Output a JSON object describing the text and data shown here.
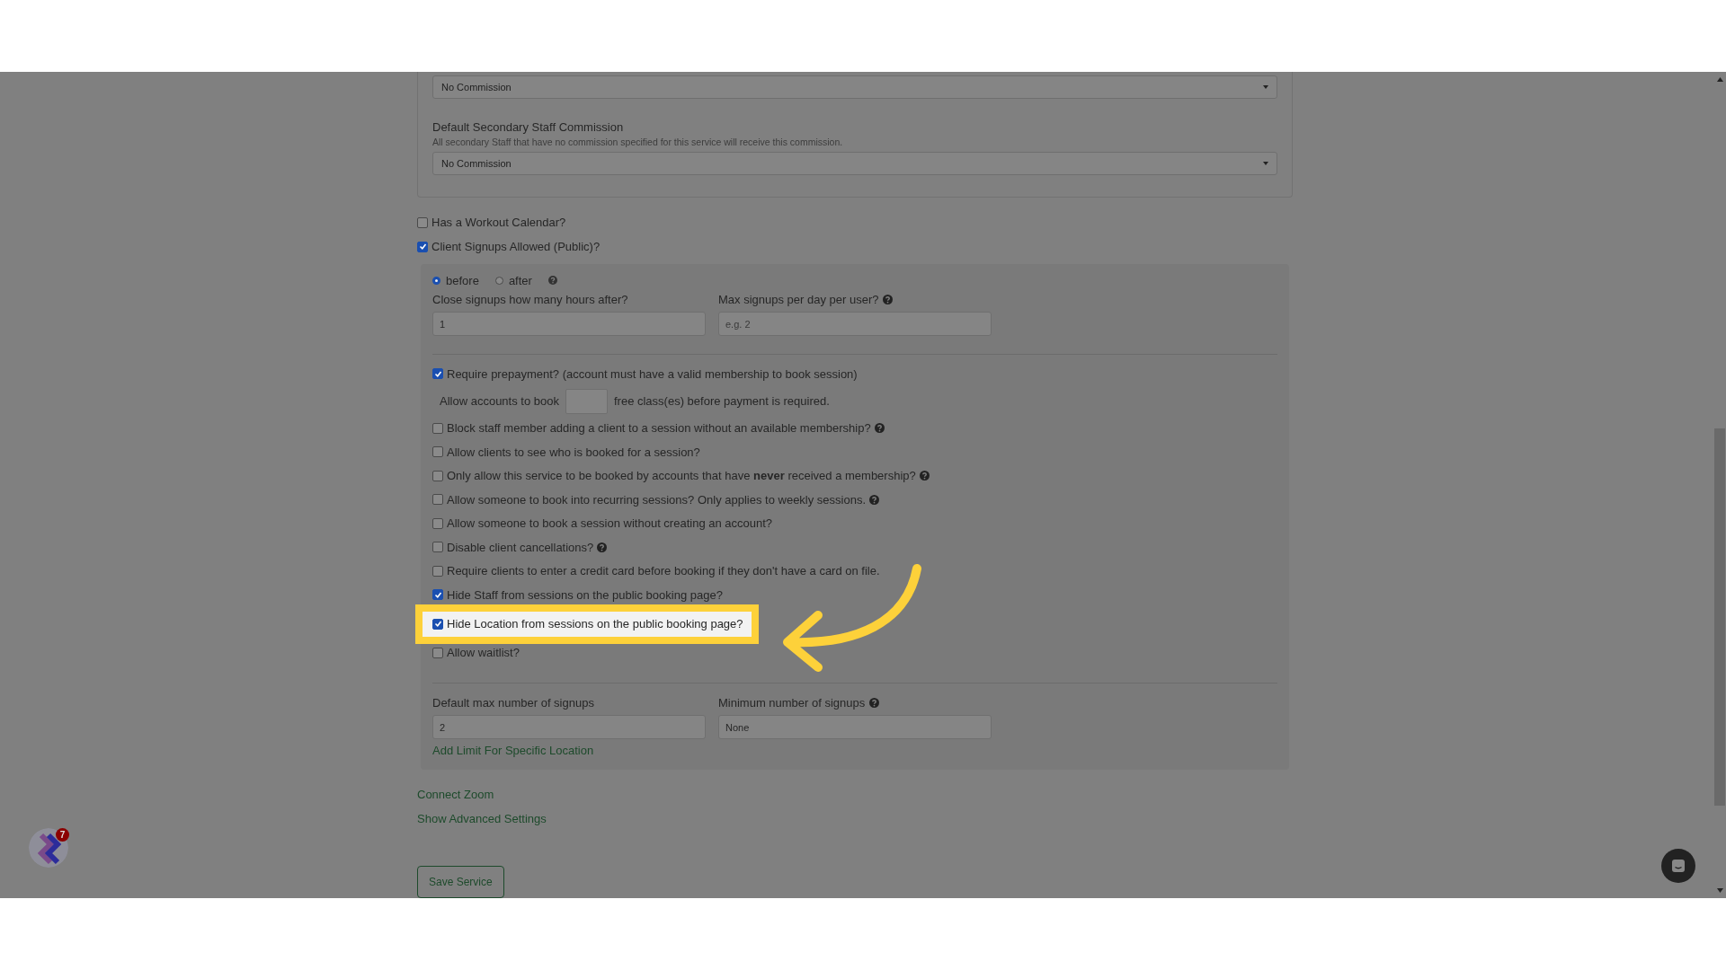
{
  "commission_panel": {
    "primary_select": {
      "value": "No Commission"
    },
    "secondary": {
      "label": "Default Secondary Staff Commission",
      "help": "All secondary Staff that have no commission specified for this service will receive this commission.",
      "select": {
        "value": "No Commission"
      }
    }
  },
  "options": [
    {
      "label": "Has a Workout Calendar?",
      "checked": false
    },
    {
      "label": "Client Signups Allowed (Public)?",
      "checked": true
    }
  ],
  "signup_panel": {
    "timing": [
      {
        "label": "before",
        "selected": true
      },
      {
        "label": "after",
        "selected": false
      }
    ],
    "fields": [
      {
        "label": "Close signups how many hours after?",
        "value": "1",
        "help": false
      },
      {
        "label": "Max signups per day per user?",
        "placeholder": "e.g. 2",
        "help": true
      }
    ],
    "settings": [
      {
        "kind": "checkbox",
        "label": "Require prepayment? (account must have a valid membership to book session)",
        "checked": true,
        "help": false,
        "highlighted": false
      },
      {
        "kind": "free-classes",
        "before": "Allow accounts to book",
        "after": "free class(es) before payment is required."
      },
      {
        "kind": "checkbox",
        "label": "Block staff member adding a client to a session without an available membership?",
        "checked": false,
        "help": true,
        "highlighted": false
      },
      {
        "kind": "checkbox",
        "label": "Allow clients to see who is booked for a session?",
        "checked": false,
        "help": false,
        "highlighted": false
      },
      {
        "kind": "checkbox",
        "label": "Only allow this service to be booked by accounts that have **never** received a membership?",
        "checked": false,
        "help": true,
        "highlighted": false
      },
      {
        "kind": "checkbox",
        "label": "Allow someone to book into recurring sessions? Only applies to weekly sessions.",
        "checked": false,
        "help": true,
        "highlighted": false
      },
      {
        "kind": "checkbox",
        "label": "Allow someone to book a session without creating an account?",
        "checked": false,
        "help": false,
        "highlighted": false
      },
      {
        "kind": "checkbox",
        "label": "Disable client cancellations?",
        "checked": false,
        "help": true,
        "highlighted": false
      },
      {
        "kind": "checkbox",
        "label": "Require clients to enter a credit card before booking if they don't have a card on file.",
        "checked": false,
        "help": false,
        "highlighted": false
      },
      {
        "kind": "checkbox",
        "label": "Hide Staff from sessions on the public booking page?",
        "checked": true,
        "help": false,
        "highlighted": false
      },
      {
        "kind": "checkbox",
        "label": "Hide Location from sessions on the public booking page?",
        "checked": true,
        "help": false,
        "highlighted": true
      },
      {
        "kind": "checkbox",
        "label": "Allow waitlist?",
        "checked": false,
        "help": false,
        "highlighted": false
      }
    ],
    "limit_fields": [
      {
        "label": "Default max number of signups",
        "value": "2",
        "help": false
      },
      {
        "label": "Minimum number of signups",
        "value": "None",
        "help": true
      }
    ],
    "add_limit_link": "Add Limit For Specific Location"
  },
  "links": [
    "Connect Zoom",
    "Show Advanced Settings"
  ],
  "save_button": "Save Service",
  "launcher": {
    "badge": "7"
  }
}
